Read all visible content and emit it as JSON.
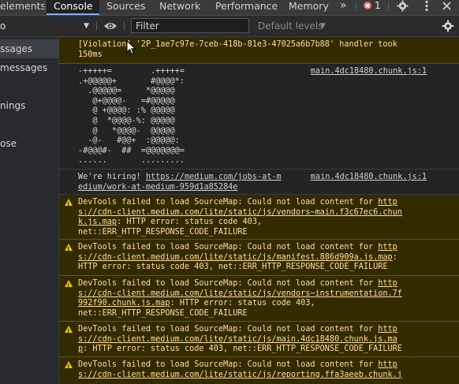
{
  "tabs": {
    "elements": "elements",
    "console": "Console",
    "sources": "Sources",
    "network": "Network",
    "performance": "Performance",
    "memory": "Memory",
    "more": "»",
    "error_count": "1"
  },
  "toolbar": {
    "context": "o",
    "filter_placeholder": "Filter",
    "levels": "Default levels"
  },
  "sidebar": {
    "items": [
      "ssages",
      " messages",
      "",
      "nings",
      "",
      "ose"
    ]
  },
  "console": {
    "violation": {
      "line1": "[Violation] '2P_1ae7c97e-7ceb-418b-81e3-47025a6b7b88' handler took",
      "line2": "150ms"
    },
    "ascii": {
      "lines": [
        "-+++++=        .+++++=",
        ".+@@@@@+       #@@@@*:",
        "  .@@@@@=     *@@@@@",
        "   @+@@@@-   =#@@@@@",
        "   @ +@@@@: :% @@@@@",
        "   @  *@@@@-%: @@@@@",
        "   @   *@@@@-  @@@@@",
        "  -@-   #@@+  :@@@@@:",
        "-#@@@#-  ##  =@@@@@@@=",
        "......       ........."
      ],
      "source": "main.4dc18480.chunk.js:1"
    },
    "hiring": {
      "prefix": "We're hiring! ",
      "link1": "https://medium.com/jobs-at-m",
      "link2": "edium/work-at-medium-959d1a85284e",
      "source": "main.4dc18480.chunk.js:1"
    },
    "warnings": [
      {
        "l1_text": "DevTools failed to load SourceMap: Could not load content for ",
        "l1_link": "http",
        "l2_link": "s://cdn-client.medium.com/lite/static/js/vendors~main.f3c67ec6.chun",
        "l3_link": "k.js.map",
        "l3_text": ": HTTP error: status code 403,",
        "l4_text": "net::ERR_HTTP_RESPONSE_CODE_FAILURE"
      },
      {
        "l1_text": "DevTools failed to load SourceMap: Could not load content for ",
        "l1_link": "http",
        "l2_link": "s://cdn-client.medium.com/lite/static/js/manifest.886d909a.js.map",
        "l2_text": ":",
        "l3_text": "HTTP error: status code 403, net::ERR_HTTP_RESPONSE_CODE_FAILURE"
      },
      {
        "l1_text": "DevTools failed to load SourceMap: Could not load content for ",
        "l1_link": "http",
        "l2_link": "s://cdn-client.medium.com/lite/static/js/vendors~instrumentation.7f",
        "l3_link": "992f90.chunk.js.map",
        "l3_text": ": HTTP error: status code 403,",
        "l4_text": "net::ERR_HTTP_RESPONSE_CODE_FAILURE"
      },
      {
        "l1_text": "DevTools failed to load SourceMap: Could not load content for ",
        "l1_link": "http",
        "l2_link": "s://cdn-client.medium.com/lite/static/js/main.4dc18480.chunk.js.ma",
        "l3_link": "p",
        "l3_text": ": HTTP error: status code 403, net::ERR_HTTP_RESPONSE_CODE_FAILURE"
      },
      {
        "l1_text": "DevTools failed to load SourceMap: Could not load content for ",
        "l1_link": "http",
        "l2_link": "s://cdn-client.medium.com/lite/static/js/reporting.ffa3aeeb.chunk.j"
      }
    ]
  },
  "colors": {
    "accent": "#7cacf8",
    "error": "#e46962",
    "warning_icon": "#f2c300",
    "warning_bg": "#332b00",
    "warning_text": "#ffdd9e"
  },
  "icons": [
    "gear-icon",
    "kebab-menu-icon",
    "eye-icon",
    "settings-gear-icon",
    "error-circle-icon",
    "warning-icon"
  ]
}
